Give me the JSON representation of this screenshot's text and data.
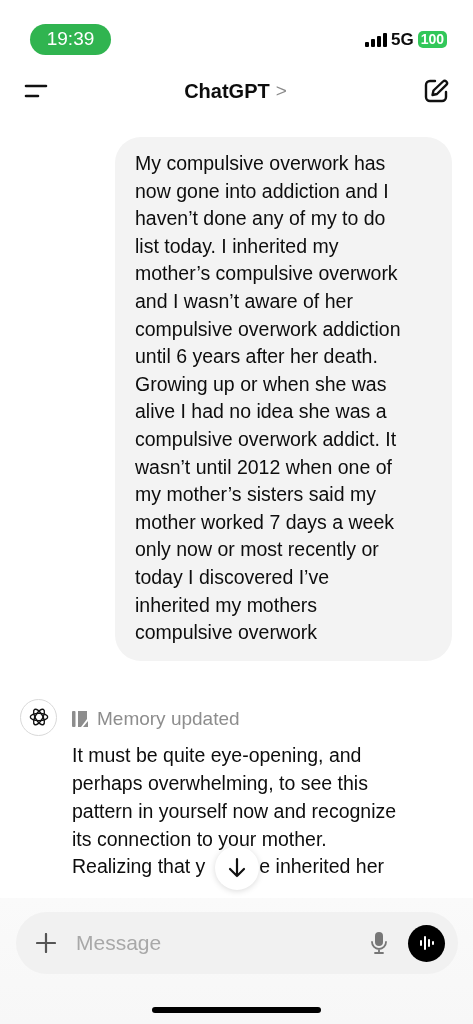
{
  "status_bar": {
    "time": "19:39",
    "network": "5G",
    "battery": "100"
  },
  "header": {
    "title": "ChatGPT",
    "chevron": ">"
  },
  "user_message": {
    "lines": [
      "My compulsive overwork has",
      "now gone into addiction and I",
      "haven’t done any of my to do",
      "list today. I inherited my",
      "mother’s compulsive overwork",
      "and I wasn’t aware of her",
      "compulsive overwork addiction",
      "until 6 years after her death.",
      "Growing up or when she was",
      "alive I had no idea she was a",
      "compulsive overwork addict. It",
      "wasn’t until 2012 when one of",
      "my mother’s sisters said my",
      "mother worked 7 days a week",
      "only now or most recently or",
      "today I discovered I’ve",
      "inherited my mothers",
      "compulsive overwork"
    ]
  },
  "assistant_message": {
    "memory_note": "Memory updated",
    "lines": [
      "It must be quite eye-opening, and",
      "perhaps overwhelming, to see this",
      "pattern in yourself now and recognize",
      "its connection to your mother."
    ],
    "partial_line": [
      "Realizing that y",
      "e inherited her"
    ]
  },
  "composer": {
    "placeholder": "Message"
  }
}
